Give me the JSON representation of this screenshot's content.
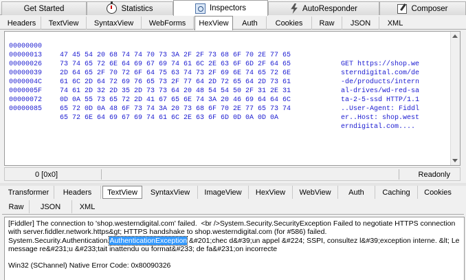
{
  "main_tabs": [
    {
      "label": "Get Started",
      "icon": "none"
    },
    {
      "label": "Statistics",
      "icon": "stopwatch-icon"
    },
    {
      "label": "Inspectors",
      "icon": "inspect-icon",
      "active": true
    },
    {
      "label": "AutoResponder",
      "icon": "bolt-icon"
    },
    {
      "label": "Composer",
      "icon": "composer-icon"
    }
  ],
  "request_tabs": [
    "Headers",
    "TextView",
    "SyntaxView",
    "WebForms",
    "HexView",
    "Auth",
    "Cookies",
    "Raw",
    "JSON",
    "XML"
  ],
  "request_active_tab": "HexView",
  "hex": {
    "rows": [
      {
        "offset": "00000000",
        "bytes": "47 45 54 20 68 74 74 70 73 3A 2F 2F 73 68 6F 70 2E 77 65",
        "ascii": "GET https://shop.we"
      },
      {
        "offset": "00000013",
        "bytes": "73 74 65 72 6E 64 69 67 69 74 61 6C 2E 63 6F 6D 2F 64 65",
        "ascii": "sterndigital.com/de"
      },
      {
        "offset": "00000026",
        "bytes": "2D 64 65 2F 70 72 6F 64 75 63 74 73 2F 69 6E 74 65 72 6E",
        "ascii": "-de/products/intern"
      },
      {
        "offset": "00000039",
        "bytes": "61 6C 2D 64 72 69 76 65 73 2F 77 64 2D 72 65 64 2D 73 61",
        "ascii": "al-drives/wd-red-sa"
      },
      {
        "offset": "0000004C",
        "bytes": "74 61 2D 32 2D 35 2D 73 73 64 20 48 54 54 50 2F 31 2E 31",
        "ascii": "ta-2-5-ssd HTTP/1.1"
      },
      {
        "offset": "0000005F",
        "bytes": "0D 0A 55 73 65 72 2D 41 67 65 6E 74 3A 20 46 69 64 64 6C",
        "ascii": "..User-Agent: Fiddl"
      },
      {
        "offset": "00000072",
        "bytes": "65 72 0D 0A 48 6F 73 74 3A 20 73 68 6F 70 2E 77 65 73 74",
        "ascii": "er..Host: shop.west"
      },
      {
        "offset": "00000085",
        "bytes": "65 72 6E 64 69 67 69 74 61 6C 2E 63 6F 6D 0D 0A 0D 0A",
        "ascii": "erndigital.com...."
      }
    ]
  },
  "status": {
    "left": "0 [0x0]",
    "right": "Readonly"
  },
  "response_tabs_row1": [
    "Transformer",
    "Headers",
    "TextView",
    "SyntaxView",
    "ImageView",
    "HexView",
    "WebView",
    "Auth",
    "Caching",
    "Cookies"
  ],
  "response_tabs_row2": [
    "Raw",
    "JSON",
    "XML"
  ],
  "response_active_tab": "TextView",
  "response": {
    "line1": "[Fiddler] The connection to 'shop.westerndigital.com' failed.  <br />System.Security.SecurityException Failed to negotiate HTTPS connection with server.fiddler.network.https&gt; HTTPS handshake to shop.westerndigital.com (for #586) failed. System.Security.Authentication.",
    "selected": "AuthenticationException",
    "line1_rest": " &#201;chec d&#39;un appel &#224; SSPI, consultez l&#39;exception interne. &lt; Le message re&#231;u &#233;tait inattendu ou format&#233; de fa&#231;on incorrecte",
    "line2": "Win32 (SChannel) Native Error Code: 0x80090326"
  }
}
